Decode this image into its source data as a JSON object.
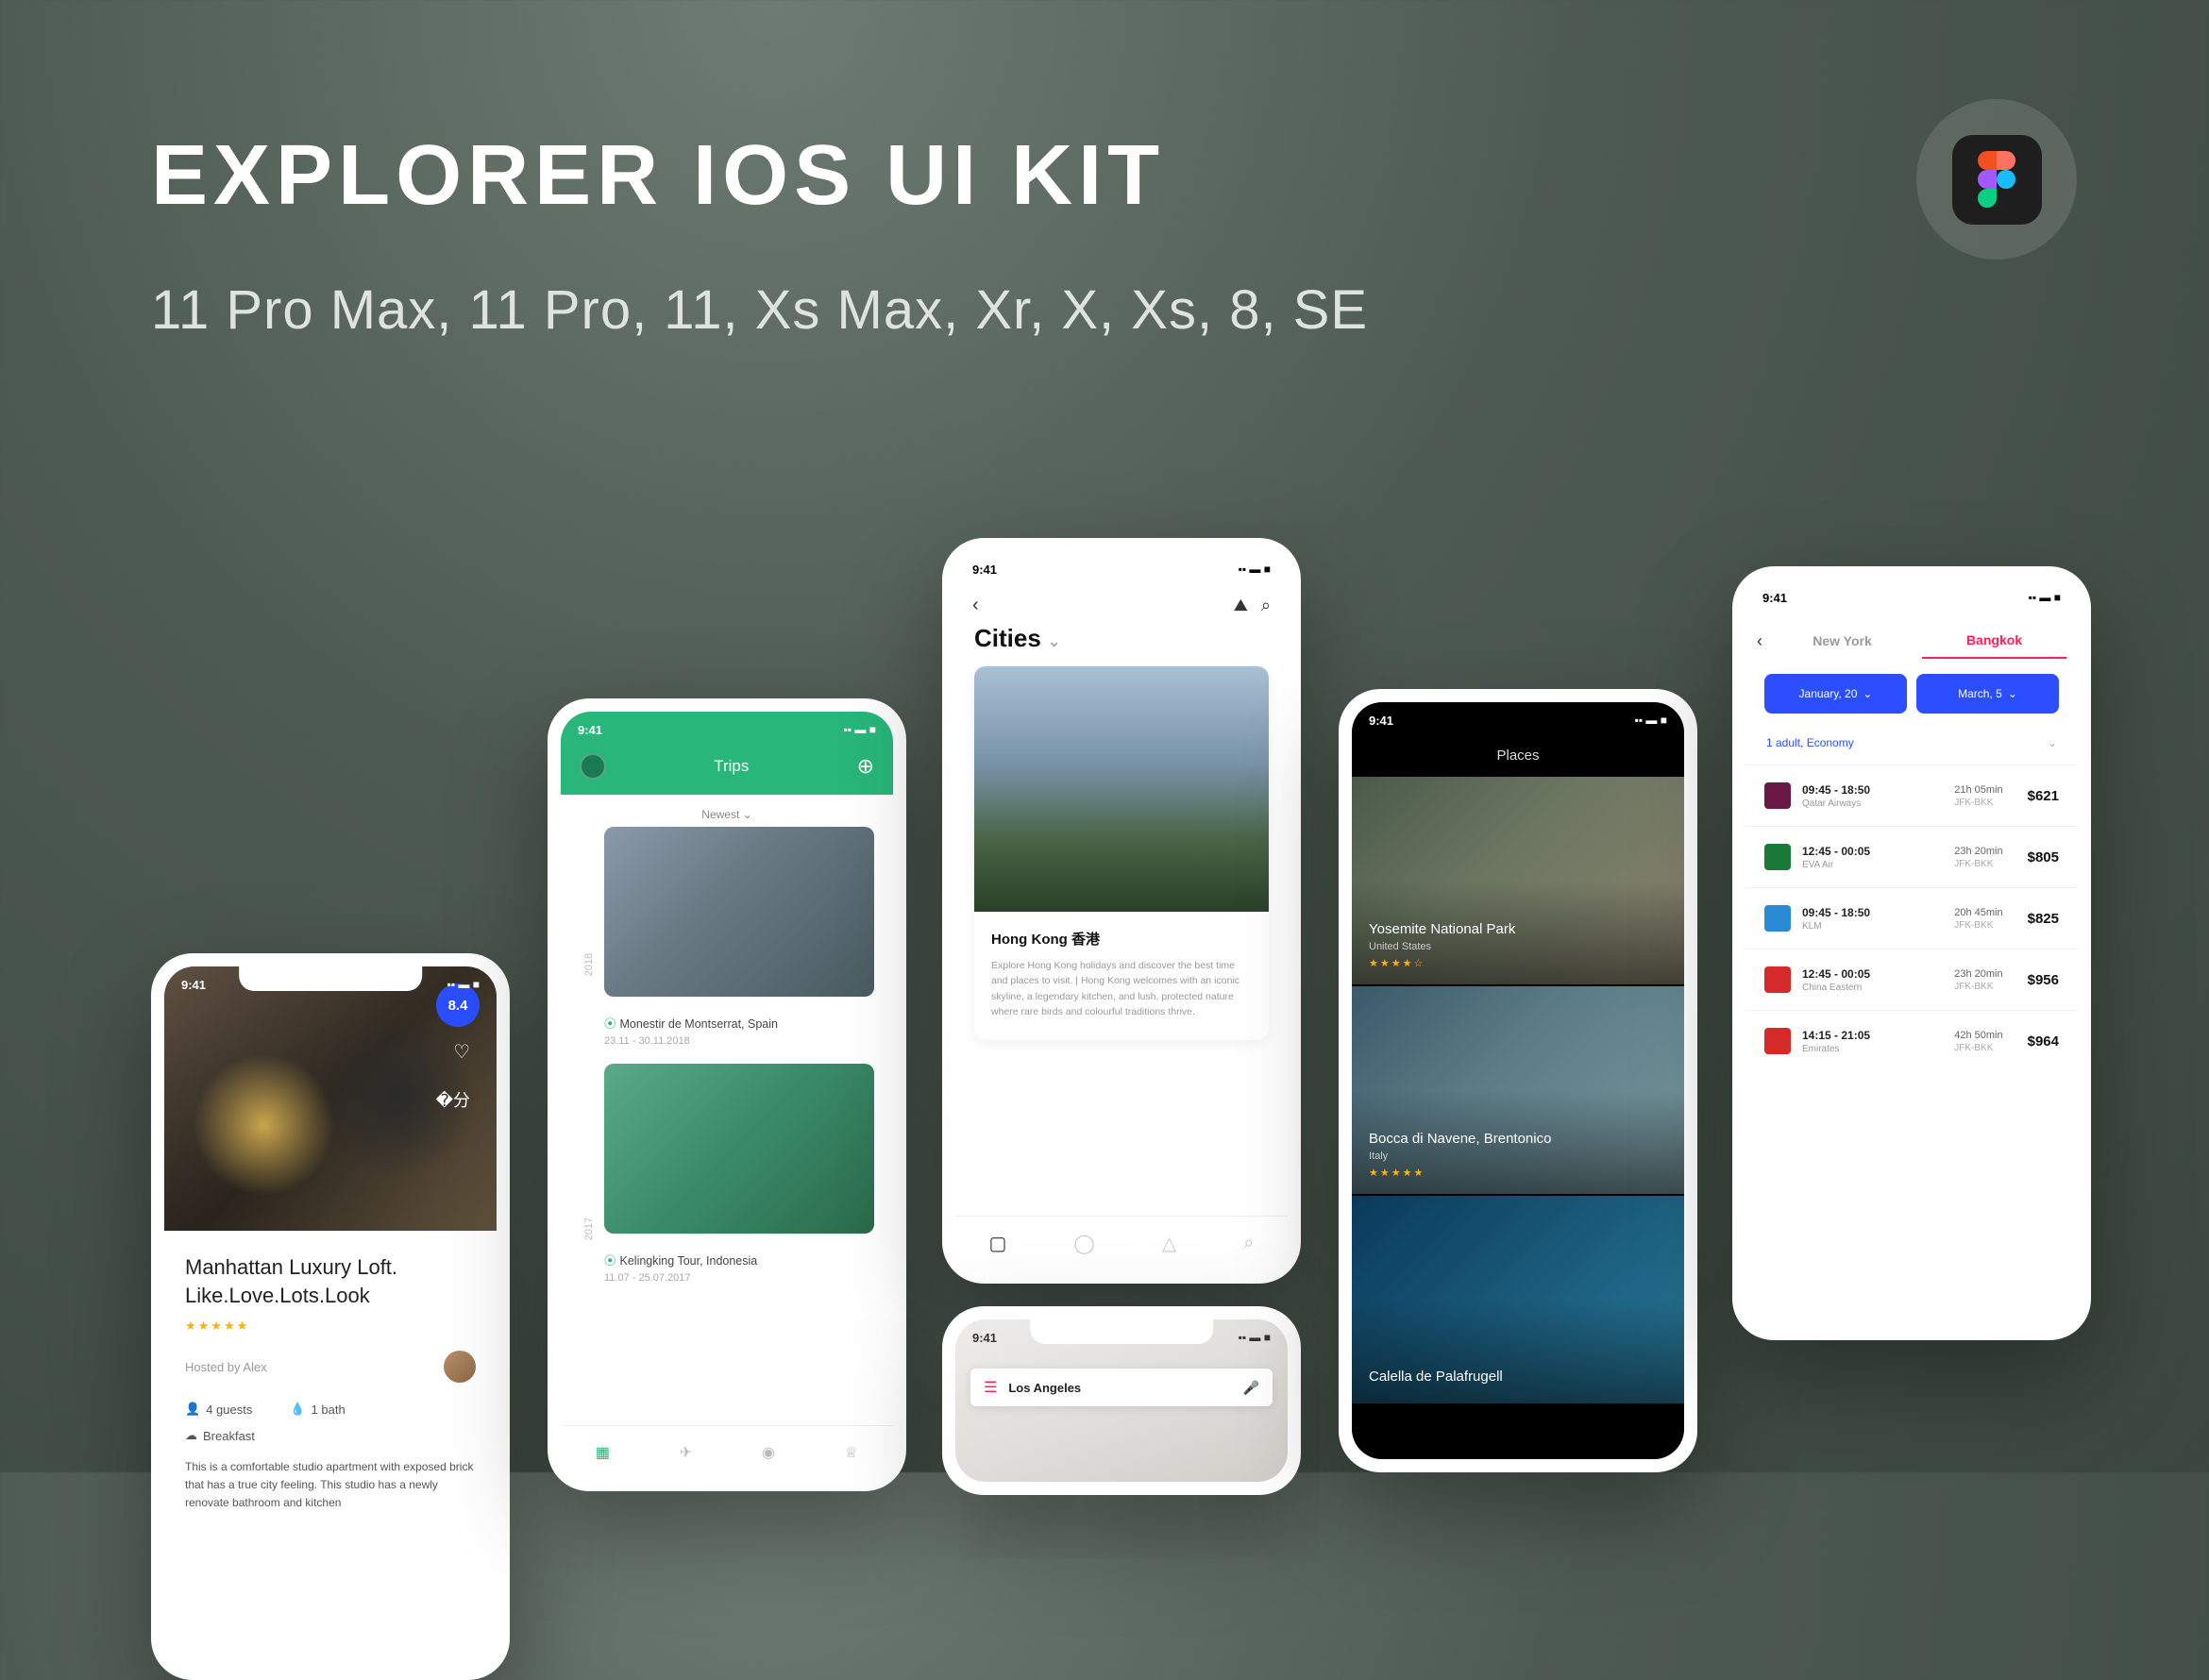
{
  "hero": {
    "title": "EXPLORER IOS UI KIT",
    "subtitle": "11 Pro Max, 11 Pro, 11, Xs Max, Xr, X, Xs, 8, SE"
  },
  "status_time": "9:41",
  "listing": {
    "rating": "8.4",
    "title": "Manhattan Luxury Loft. Like.Love.Lots.Look",
    "host_label": "Hosted by Alex",
    "guests": "4 guests",
    "bath": "1 bath",
    "breakfast": "Breakfast",
    "description": "This is a comfortable studio apartment with exposed brick that has a true city feeling. This studio has a newly renovate bathroom and kitchen"
  },
  "trips": {
    "title": "Trips",
    "sort": "Newest",
    "year1": "2018",
    "year2": "2017",
    "items": [
      {
        "place": "Monestir de Montserrat, Spain",
        "dates": "23.11 - 30.11.2018"
      },
      {
        "place": "Kelingking Tour, Indonesia",
        "dates": "11.07 - 25.07.2017"
      }
    ]
  },
  "cities": {
    "heading": "Cities",
    "card": {
      "name": "Hong Kong 香港",
      "desc": "Explore Hong Kong holidays and discover the best time and places to visit. | Hong Kong welcomes with an iconic skyline, a legendary kitchen, and lush, protected nature where rare birds and colourful traditions thrive."
    }
  },
  "map": {
    "search": "Los Angeles"
  },
  "places": {
    "title": "Places",
    "items": [
      {
        "name": "Yosemite National Park",
        "sub": "United States"
      },
      {
        "name": "Bocca di Navene, Brentonico",
        "sub": "Italy"
      },
      {
        "name": "Calella de Palafrugell",
        "sub": ""
      }
    ]
  },
  "flights": {
    "from": "New York",
    "to": "Bangkok",
    "date1": "January, 20",
    "date2": "March, 5",
    "pax": "1 adult, Economy",
    "route": "JFK-BKK",
    "rows": [
      {
        "times": "09:45 - 18:50",
        "airline": "Qatar Airways",
        "dur": "21h 05min",
        "price": "$621",
        "color": "#6a1846"
      },
      {
        "times": "12:45 - 00:05",
        "airline": "EVA Air",
        "dur": "23h 20min",
        "price": "$805",
        "color": "#1a7a3a"
      },
      {
        "times": "09:45 - 18:50",
        "airline": "KLM",
        "dur": "20h 45min",
        "price": "$825",
        "color": "#2a8ad4"
      },
      {
        "times": "12:45 - 00:05",
        "airline": "China Eastern",
        "dur": "23h 20min",
        "price": "$956",
        "color": "#d42a2a"
      },
      {
        "times": "14:15 - 21:05",
        "airline": "Emirates",
        "dur": "42h 50min",
        "price": "$964",
        "color": "#d42a2a"
      }
    ]
  }
}
